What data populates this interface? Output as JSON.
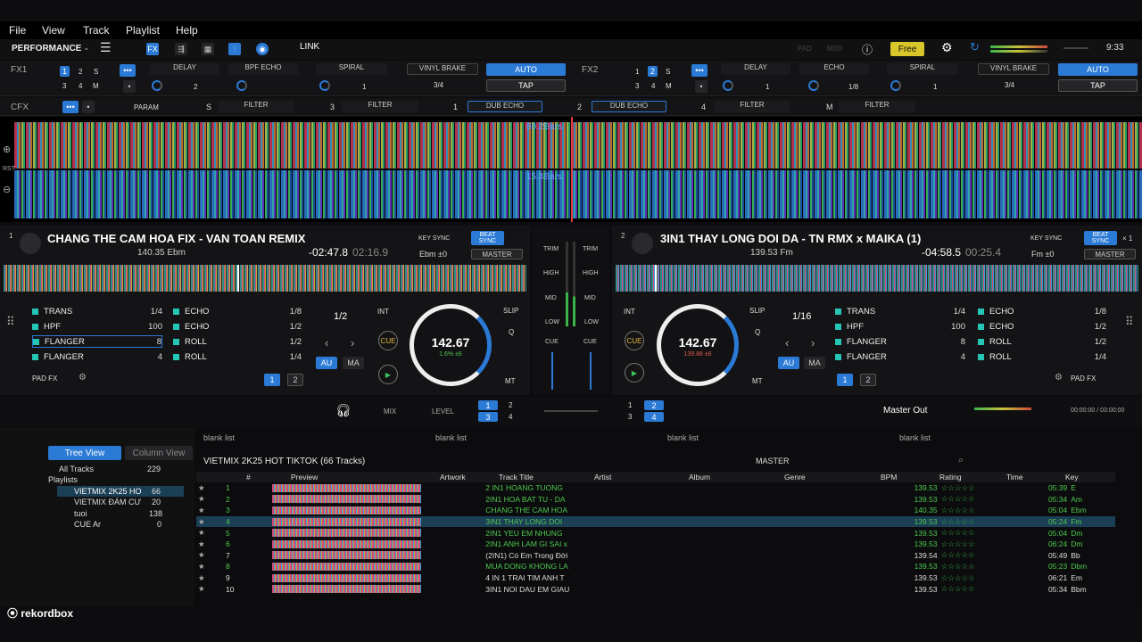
{
  "menu": [
    "File",
    "View",
    "Track",
    "Playlist",
    "Help"
  ],
  "toolbar": {
    "mode": "PERFORMANCE",
    "link": "LINK",
    "pad": "PAD",
    "midi": "MIDI",
    "free": "Free",
    "clock": "9:33"
  },
  "fx1": {
    "label": "FX1",
    "b1": "1",
    "b2": "2",
    "b3": "S",
    "b4": "3",
    "b5": "4",
    "b6": "M",
    "slot1": "DELAY",
    "slot2": "BPF ECHO",
    "slot3": "SPIRAL",
    "v1": "2",
    "v2": "1",
    "brake": "VINYL BRAKE",
    "beat": "3/4",
    "auto": "AUTO",
    "tap": "TAP"
  },
  "fx2": {
    "label": "FX2",
    "b1": "1",
    "b2": "2",
    "b3": "S",
    "b4": "3",
    "b5": "4",
    "b6": "M",
    "slot1": "DELAY",
    "slot2": "ECHO",
    "slot3": "SPIRAL",
    "v1": "1",
    "v2": "1/8",
    "v3": "1",
    "brake": "VINYL BRAKE",
    "beat": "3/4",
    "auto": "AUTO",
    "tap": "TAP"
  },
  "cfx": {
    "label": "CFX",
    "param": "PARAM",
    "s": "S",
    "f1": "FILTER",
    "n3": "3",
    "f2": "FILTER",
    "n1": "1",
    "dub1": "DUB ECHO",
    "n2": "2",
    "dub2": "DUB ECHO",
    "n4": "4",
    "f3": "FILTER",
    "m": "M",
    "f4": "FILTER"
  },
  "waves": {
    "bars1": "80.2Bars",
    "bars2": "15.4Bars",
    "rst": "RST"
  },
  "deck1": {
    "num": "1",
    "title": "CHANG THE CAM HOA FIX - VAN TOAN REMIX",
    "bpmkey": "140.35  Ebm",
    "remain": "-02:47.8",
    "elapsed": "02:16.9",
    "keysync": "KEY SYNC",
    "beatsync": "BEAT SYNC",
    "key": "Ebm ±0",
    "master": "MASTER",
    "loop": "1/2",
    "int": "INT",
    "slip": "SLIP",
    "cue": "CUE",
    "q": "Q",
    "au": "AU",
    "ma": "MA",
    "mt": "MT",
    "bpm": "142.67",
    "pitch": "1.6%  ±6",
    "padfx": "PAD FX",
    "p1": "1",
    "p2": "2"
  },
  "deck1pads": [
    {
      "n": "TRANS",
      "v": "1/4"
    },
    {
      "n": "HPF",
      "v": "100"
    },
    {
      "n": "FLANGER",
      "v": "8"
    },
    {
      "n": "FLANGER",
      "v": "4"
    },
    {
      "n": "ECHO",
      "v": "1/8"
    },
    {
      "n": "ECHO",
      "v": "1/2"
    },
    {
      "n": "ROLL",
      "v": "1/2"
    },
    {
      "n": "ROLL",
      "v": "1/4"
    }
  ],
  "deck2": {
    "num": "2",
    "title": "3IN1 THAY LONG DOI DA - TN RMX x MAIKA (1)",
    "bpmkey": "139.53  Fm",
    "remain": "-04:58.5",
    "elapsed": "00:25.4",
    "keysync": "KEY SYNC",
    "beatsync": "BEAT SYNC",
    "key": "Fm ±0",
    "master": "MASTER",
    "loop": "1/16",
    "int": "INT",
    "slip": "SLIP",
    "cue": "CUE",
    "q": "Q",
    "au": "AU",
    "ma": "MA",
    "mt": "MT",
    "bpm": "142.67",
    "pitch": "139.88  ±6",
    "padfx": "PAD FX",
    "p1": "1",
    "p2": "2",
    "x1": "× 1"
  },
  "deck2pads": [
    {
      "n": "TRANS",
      "v": "1/4"
    },
    {
      "n": "HPF",
      "v": "100"
    },
    {
      "n": "FLANGER",
      "v": "8"
    },
    {
      "n": "FLANGER",
      "v": "4"
    },
    {
      "n": "ECHO",
      "v": "1/8"
    },
    {
      "n": "ECHO",
      "v": "1/2"
    },
    {
      "n": "ROLL",
      "v": "1/2"
    },
    {
      "n": "ROLL",
      "v": "1/4"
    }
  ],
  "mixer": {
    "trim": "TRIM",
    "high": "HIGH",
    "mid": "MID",
    "low": "LOW",
    "cue": "CUE",
    "mix": "MIX",
    "level": "LEVEL",
    "masterout": "Master Out",
    "time": "00:00:00 / 03:00:00",
    "d1": "1",
    "d2": "2",
    "d3": "3",
    "d4": "4"
  },
  "browser": {
    "treeview": "Tree View",
    "columnview": "Column View",
    "alltracks": "All Tracks",
    "allcount": "229",
    "playlists": "Playlists",
    "pl": [
      {
        "n": "VIETMIX 2K25 HO",
        "c": "66"
      },
      {
        "n": "VIETMIX ĐÁM CƯ",
        "c": "20"
      },
      {
        "n": "tuoi",
        "c": "138"
      },
      {
        "n": "CUE Ar",
        "c": "0"
      }
    ],
    "blank": "blank list",
    "listtitle": "VIETMIX 2K25 HOT TIKTOK (66 Tracks)",
    "master": "MASTER",
    "cols": [
      "#",
      "Preview",
      "Artwork",
      "Track Title",
      "Artist",
      "Album",
      "Genre",
      "BPM",
      "Rating",
      "Time",
      "Key"
    ]
  },
  "tracks": [
    {
      "no": "1",
      "t": "2 IN1 HOANG TUONG",
      "bpm": "139.53",
      "time": "05:39",
      "key": "E",
      "g": true
    },
    {
      "no": "2",
      "t": "2IN1 HOA BAT TU - DA",
      "bpm": "139.53",
      "time": "05:34",
      "key": "Am",
      "g": true
    },
    {
      "no": "3",
      "t": "CHANG THE CAM HOA",
      "bpm": "140.35",
      "time": "05:04",
      "key": "Ebm",
      "g": true
    },
    {
      "no": "4",
      "t": "3IN1 THAY LONG DOI",
      "bpm": "139.53",
      "time": "05:24",
      "key": "Fm",
      "g": true,
      "sel": true
    },
    {
      "no": "5",
      "t": "2IN1 YEU EM NHUNG",
      "bpm": "139.53",
      "time": "05:04",
      "key": "Dm",
      "g": true
    },
    {
      "no": "6",
      "t": "2IN1 ANH LAM GI SAI x",
      "bpm": "139.53",
      "time": "06:24",
      "key": "Dm",
      "g": true
    },
    {
      "no": "7",
      "t": "(2IN1) Có Em Trong Đời",
      "bpm": "139.54",
      "time": "05:49",
      "key": "Bb",
      "g": false
    },
    {
      "no": "8",
      "t": "MUA DONG KHONG LA",
      "bpm": "139.53",
      "time": "05:23",
      "key": "Dbm",
      "g": true
    },
    {
      "no": "9",
      "t": "4 IN 1 TRAI TIM ANH T",
      "bpm": "139.53",
      "time": "06:21",
      "key": "Em",
      "g": false
    },
    {
      "no": "10",
      "t": "3IN1 NOI DAU EM GIAU",
      "bpm": "139.53",
      "time": "05:34",
      "key": "Bbm",
      "g": false
    }
  ],
  "logo": "rekordbox"
}
